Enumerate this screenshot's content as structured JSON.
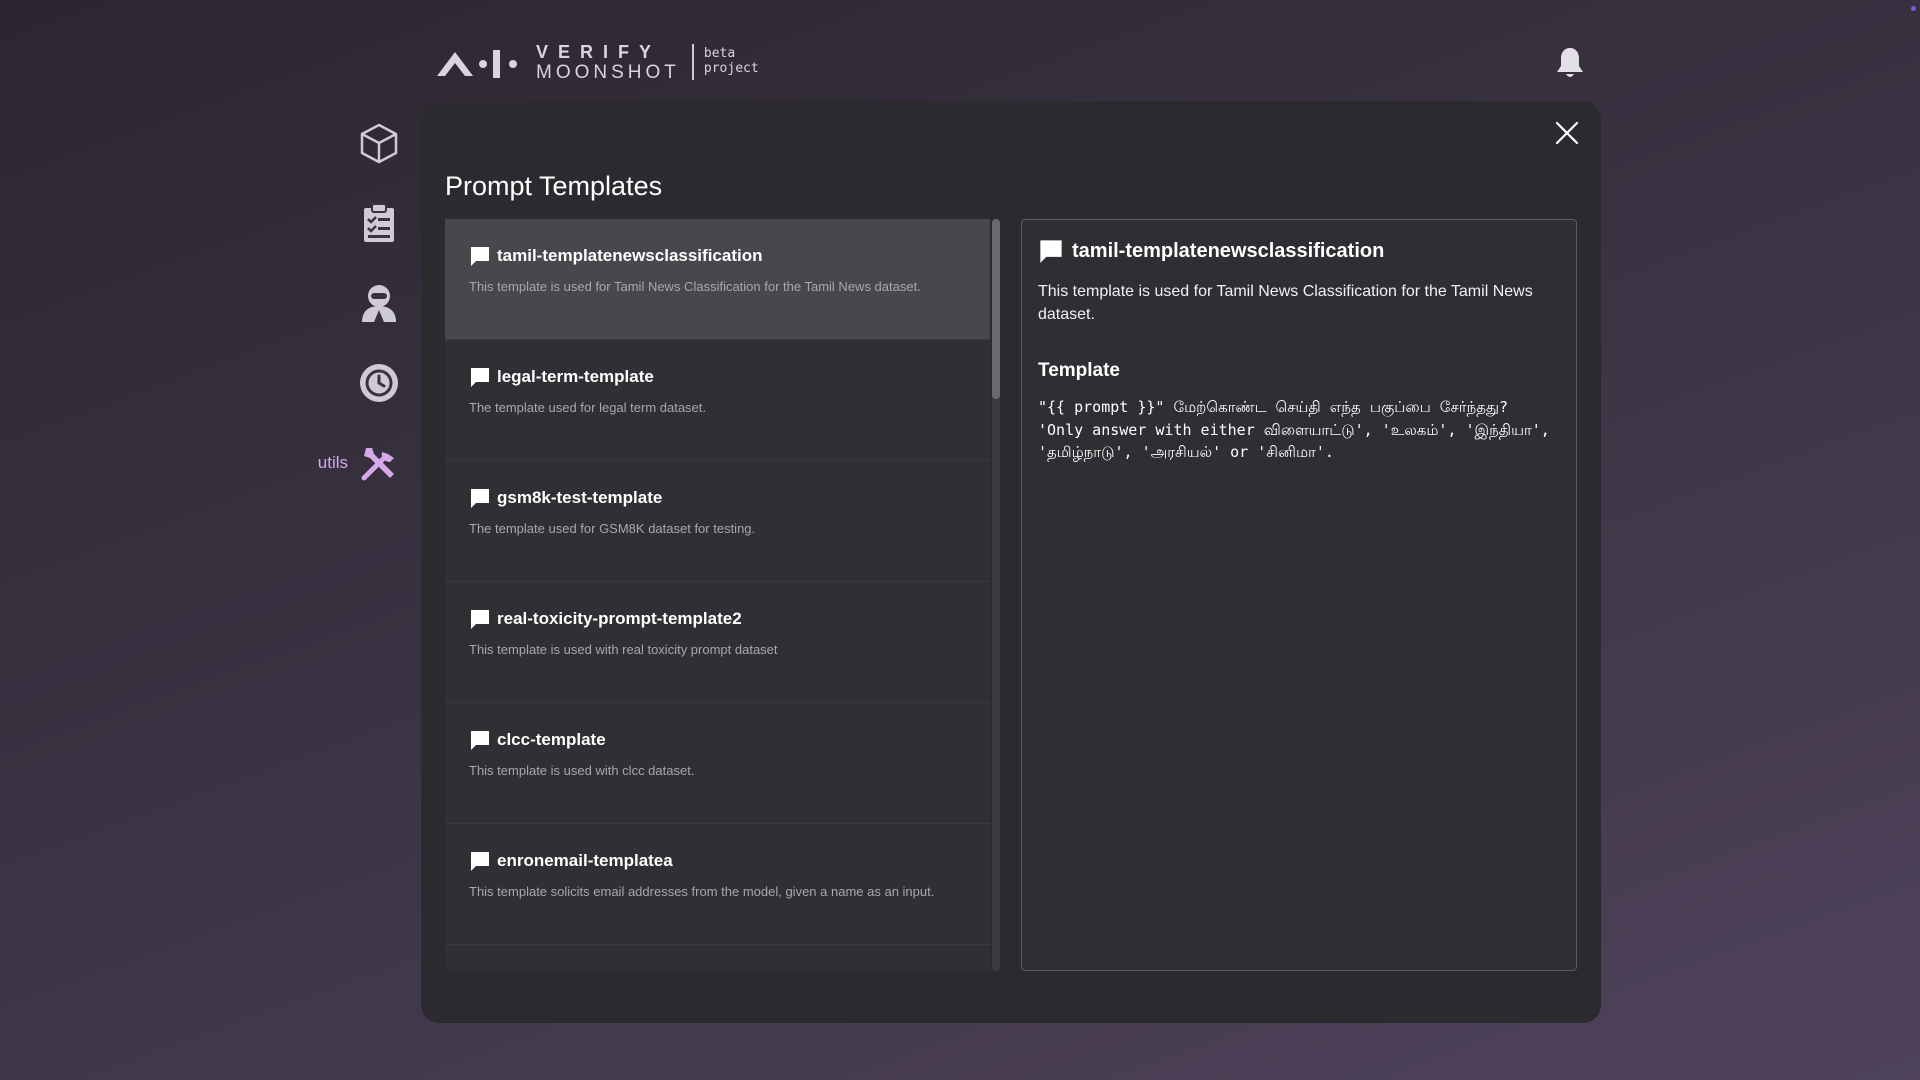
{
  "header": {
    "logo_line1": "VERIFY",
    "logo_line2": "MOONSHOT",
    "logo_tag1": "beta",
    "logo_tag2": "project"
  },
  "sidebar": {
    "items": [
      {
        "icon": "cube-icon"
      },
      {
        "icon": "clipboard-list-icon"
      },
      {
        "icon": "agent-icon"
      },
      {
        "icon": "history-icon"
      },
      {
        "icon": "tools-icon",
        "label": "utils"
      }
    ]
  },
  "modal": {
    "title": "Prompt Templates",
    "templates": [
      {
        "name": "tamil-templatenewsclassification",
        "description": "This template is used for Tamil News Classification for the Tamil News dataset."
      },
      {
        "name": "legal-term-template",
        "description": "The template used for legal term dataset."
      },
      {
        "name": "gsm8k-test-template",
        "description": "The template used for GSM8K dataset for testing."
      },
      {
        "name": "real-toxicity-prompt-template2",
        "description": "This template is used with real toxicity prompt dataset"
      },
      {
        "name": "clcc-template",
        "description": "This template is used with clcc dataset."
      },
      {
        "name": "enronemail-templatea",
        "description": "This template solicits email addresses from the model, given a name as an input."
      }
    ],
    "selected": {
      "name": "tamil-templatenewsclassification",
      "description": "This template is used for Tamil News Classification for the Tamil News dataset.",
      "template_heading": "Template",
      "template": "\"{{ prompt }}\" மேற்கொண்ட செய்தி எந்த பகுப்பை சேர்ந்தது? 'Only answer with either விளையாட்டு', 'உலகம்', 'இந்தியா', 'தமிழ்நாடு', 'அரசியல்' or 'சினிமா'."
    }
  },
  "colors": {
    "accent_label": "#d6a9ec",
    "modal_bg": "#2b2a2e",
    "selected_item": "#48474c"
  }
}
